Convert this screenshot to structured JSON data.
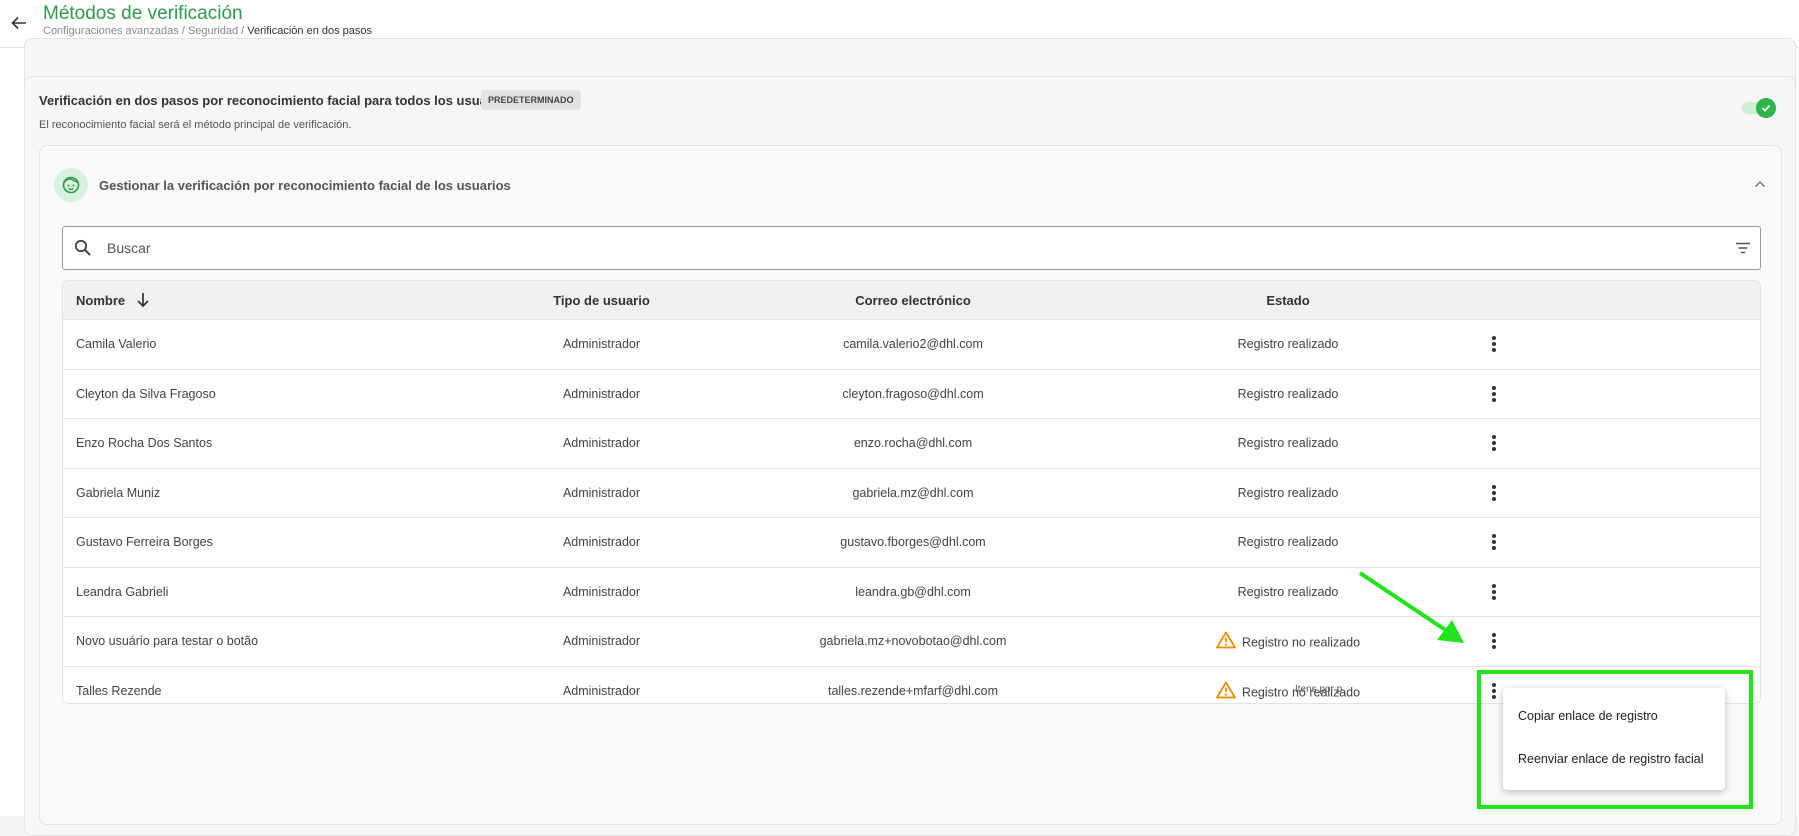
{
  "header": {
    "title": "Métodos de verificación",
    "breadcrumb": {
      "item1": "Configuraciones avanzadas",
      "sep1": " / ",
      "item2": "Seguridad",
      "sep2": " / ",
      "current": "Verificación en dos pasos"
    }
  },
  "section": {
    "title": "Verificación en dos pasos por reconocimiento facial para todos los usuarios",
    "badge": "PREDETERMINADO",
    "description": "El reconocimiento facial será el método principal de verificación.",
    "toggle_on": true
  },
  "accordion": {
    "title": "Gestionar la verificación por reconocimiento facial de los usuarios"
  },
  "search": {
    "placeholder": "Buscar"
  },
  "table": {
    "headers": {
      "name": "Nombre",
      "type": "Tipo de usuario",
      "email": "Correo electrónico",
      "state": "Estado"
    },
    "rows": [
      {
        "name": "Camila Valerio",
        "type": "Administrador",
        "email": "camila.valerio2@dhl.com",
        "state": "Registro realizado",
        "warning": false
      },
      {
        "name": "Cleyton da Silva Fragoso",
        "type": "Administrador",
        "email": "cleyton.fragoso@dhl.com",
        "state": "Registro realizado",
        "warning": false
      },
      {
        "name": "Enzo Rocha Dos Santos",
        "type": "Administrador",
        "email": "enzo.rocha@dhl.com",
        "state": "Registro realizado",
        "warning": false
      },
      {
        "name": "Gabriela Muniz",
        "type": "Administrador",
        "email": "gabriela.mz@dhl.com",
        "state": "Registro realizado",
        "warning": false
      },
      {
        "name": "Gustavo Ferreira Borges",
        "type": "Administrador",
        "email": "gustavo.fborges@dhl.com",
        "state": "Registro realizado",
        "warning": false
      },
      {
        "name": "Leandra Gabrieli",
        "type": "Administrador",
        "email": "leandra.gb@dhl.com",
        "state": "Registro realizado",
        "warning": false
      },
      {
        "name": "Novo usuário para testar o botão",
        "type": "Administrador",
        "email": "gabriela.mz+novobotao@dhl.com",
        "state": "Registro no realizado",
        "warning": true
      },
      {
        "name": "Talles Rezende",
        "type": "Administrador",
        "email": "talles.rezende+mfarf@dhl.com",
        "state": "Registro no realizado",
        "warning": true
      }
    ],
    "footer_text": "Itens por p"
  },
  "context_menu": {
    "items": [
      "Copiar enlace de registro",
      "Reenviar enlace de registro facial"
    ]
  },
  "colors": {
    "brand_green": "#2e9a4a",
    "warning_orange": "#f08c00",
    "annotation_green": "#22e31c"
  }
}
